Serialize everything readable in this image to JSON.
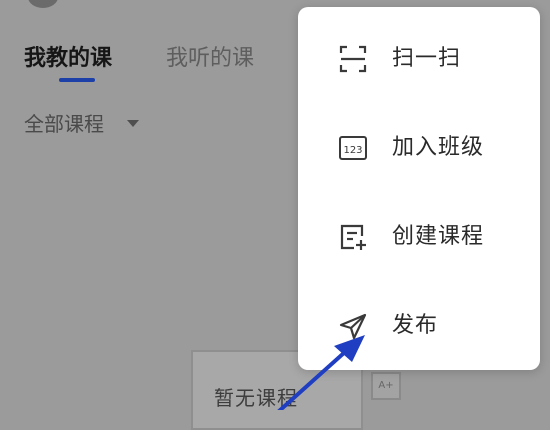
{
  "tabs": {
    "teach_label": "我教的课",
    "listen_label": "我听的课"
  },
  "filter": {
    "label": "全部课程"
  },
  "empty_state": {
    "text": "暂无课程"
  },
  "menu": {
    "items": [
      {
        "label": "扫一扫",
        "icon": "scan-icon"
      },
      {
        "label": "加入班级",
        "icon": "join-class-icon"
      },
      {
        "label": "创建课程",
        "icon": "create-course-icon"
      },
      {
        "label": "发布",
        "icon": "send-icon"
      }
    ]
  },
  "colors": {
    "accent": "#1d3fa8",
    "overlay": "#9b9b9b",
    "menu_bg": "#ffffff",
    "annotation_arrow": "#1f3ec2"
  }
}
